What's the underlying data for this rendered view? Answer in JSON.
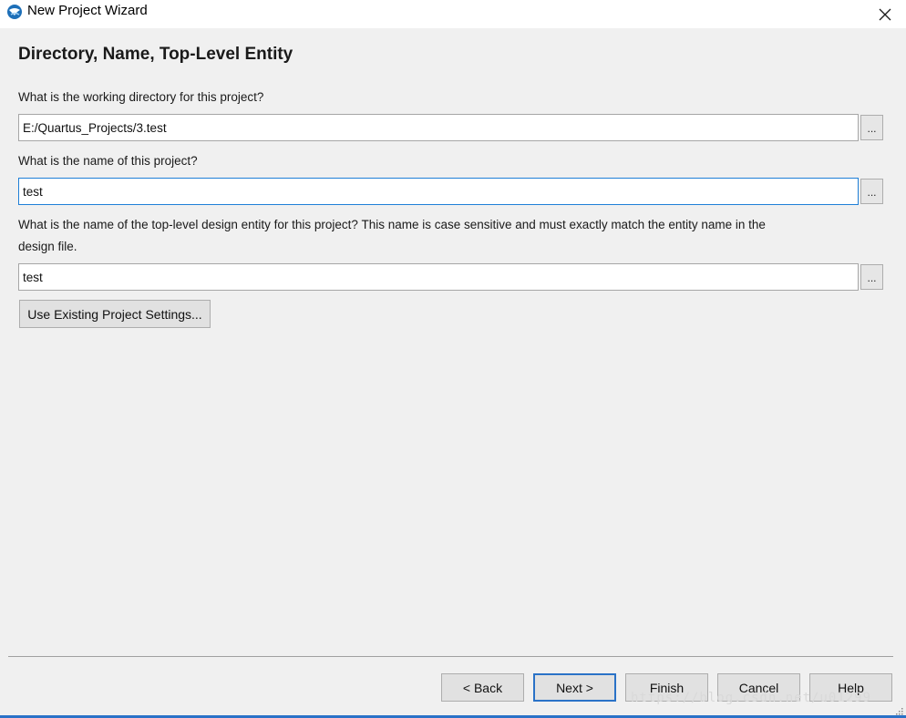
{
  "window": {
    "title": "New Project Wizard",
    "icon": "quartus-globe-icon",
    "close_icon": "close-icon"
  },
  "page": {
    "heading": "Directory, Name, Top-Level Entity"
  },
  "form": {
    "directory": {
      "label": "What is the working directory for this project?",
      "value": "E:/Quartus_Projects/3.test",
      "browse_label": "..."
    },
    "project_name": {
      "label": "What is the name of this project?",
      "value": "test",
      "browse_label": "..."
    },
    "top_level": {
      "label_line1": "What is the name of the top-level design entity for this project? This name is case sensitive and must exactly match the entity name in the",
      "label_line2": "design file.",
      "value": "test",
      "browse_label": "..."
    },
    "use_existing_label": "Use Existing Project Settings..."
  },
  "footer": {
    "back_label": "< Back",
    "next_label": "Next >",
    "finish_label": "Finish",
    "cancel_label": "Cancel",
    "help_label": "Help"
  },
  "watermark": "https://blog.csdn.net/u01299",
  "colors": {
    "background": "#f0f0f0",
    "focus_border": "#1e7fd7",
    "default_button_border": "#2a72c7"
  }
}
